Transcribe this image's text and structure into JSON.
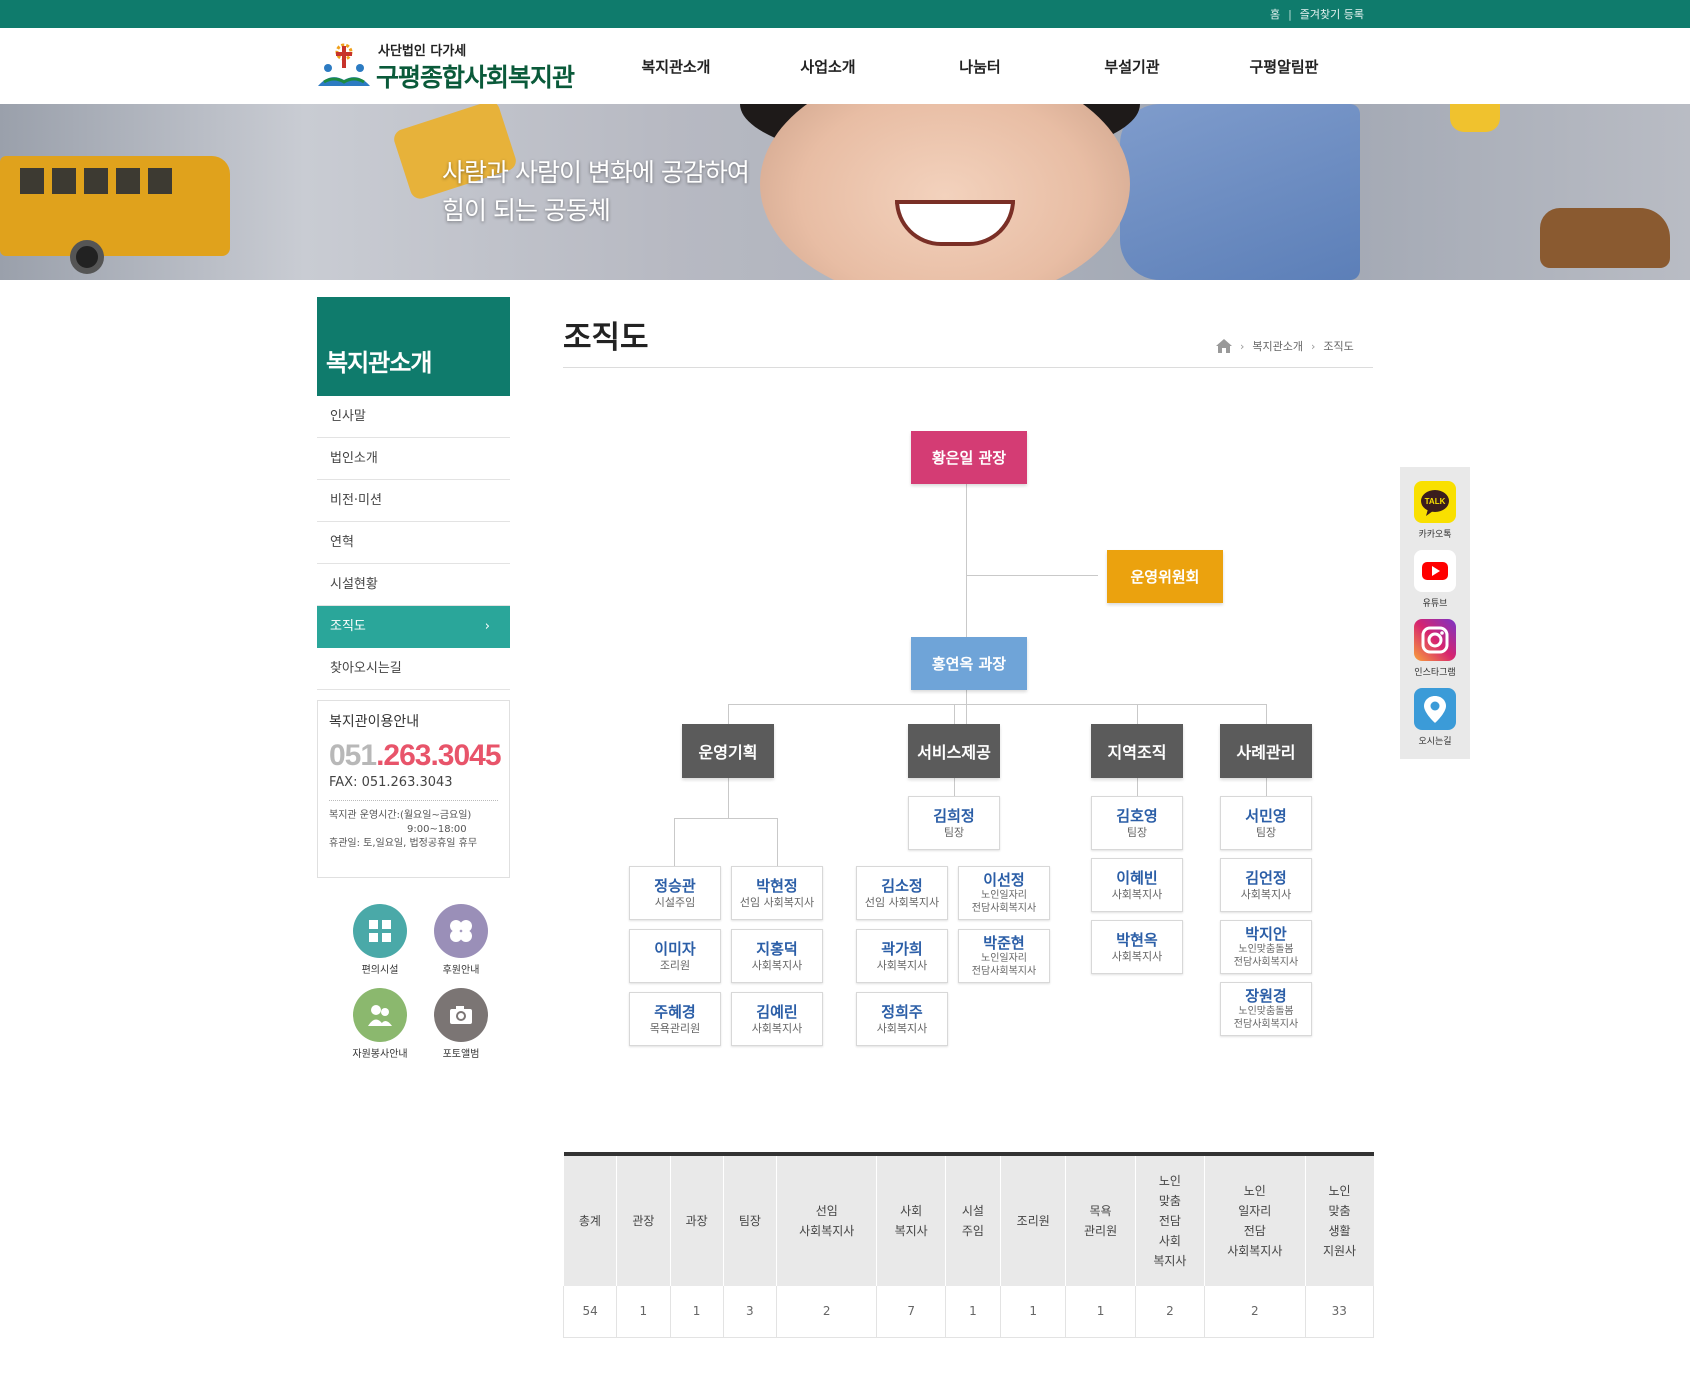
{
  "topbar": {
    "home": "홈",
    "separator": "|",
    "bookmark": "즐겨찾기 등록"
  },
  "logo": {
    "sub": "사단법인 다가세",
    "title": "구평종합사회복지관"
  },
  "gnb": [
    "복지관소개",
    "사업소개",
    "나눔터",
    "부설기관",
    "구평알림판"
  ],
  "banner": {
    "line1": "사람과 사람이 변화에 공감하여",
    "line2": "힘이 되는 공동체"
  },
  "sidebar": {
    "title": "복지관소개",
    "items": [
      {
        "label": "인사말"
      },
      {
        "label": "법인소개"
      },
      {
        "label": "비전·미션"
      },
      {
        "label": "연혁"
      },
      {
        "label": "시설현황"
      },
      {
        "label": "조직도",
        "arrow": "›"
      },
      {
        "label": "찾아오시는길"
      }
    ]
  },
  "info": {
    "title": "복지관이용안내",
    "tel_a": "051",
    "tel_b": ".263.3045",
    "fax": "FAX: 051.263.3043",
    "hours1": "복지관 운영시간:(월요일~금요일)",
    "hours2": "9:00~18:00",
    "holiday": "휴관일: 토,일요일, 법정공휴일 휴무"
  },
  "quick": [
    {
      "label": "편의시설",
      "color": "#4aa9a8"
    },
    {
      "label": "후원안내",
      "color": "#9a8fb8"
    },
    {
      "label": "자원봉사안내",
      "color": "#8bb86e"
    },
    {
      "label": "포토앨범",
      "color": "#7b7574"
    }
  ],
  "page": {
    "title": "조직도"
  },
  "breadcrumb": [
    "복지관소개",
    "조직도"
  ],
  "org": {
    "director": "황은일 관장",
    "committee": "운영위원회",
    "manager": "홍연옥 과장",
    "teams": [
      "운영기획",
      "서비스제공",
      "지역조직",
      "사례관리"
    ],
    "planning": [
      {
        "name": "정승관",
        "role": "시설주임"
      },
      {
        "name": "박현정",
        "role": "선임 사회복지사"
      },
      {
        "name": "이미자",
        "role": "조리원"
      },
      {
        "name": "지홍덕",
        "role": "사회복지사"
      },
      {
        "name": "주혜경",
        "role": "목욕관리원"
      },
      {
        "name": "김예린",
        "role": "사회복지사"
      }
    ],
    "service_head": {
      "name": "김희정",
      "role": "팀장"
    },
    "service": [
      {
        "name": "김소정",
        "role": "선임 사회복지사"
      },
      {
        "name": "이선정",
        "role1": "노인일자리",
        "role2": "전담사회복지사"
      },
      {
        "name": "곽가희",
        "role": "사회복지사"
      },
      {
        "name": "박준현",
        "role1": "노인일자리",
        "role2": "전담사회복지사"
      },
      {
        "name": "정희주",
        "role": "사회복지사"
      }
    ],
    "community_head": {
      "name": "김호영",
      "role": "팀장"
    },
    "community": [
      {
        "name": "이혜빈",
        "role": "사회복지사"
      },
      {
        "name": "박현옥",
        "role": "사회복지사"
      }
    ],
    "case_head": {
      "name": "서민영",
      "role": "팀장"
    },
    "case": [
      {
        "name": "김언정",
        "role": "사회복지사"
      },
      {
        "name": "박지안",
        "role1": "노인맞춤돌봄",
        "role2": "전담사회복지사"
      },
      {
        "name": "장원경",
        "role1": "노인맞춤돌봄",
        "role2": "전담사회복지사"
      }
    ]
  },
  "table": {
    "headers": [
      [
        "총계"
      ],
      [
        "관장"
      ],
      [
        "과장"
      ],
      [
        "팀장"
      ],
      [
        "선임",
        "사회복지사"
      ],
      [
        "사회",
        "복지사"
      ],
      [
        "시설",
        "주임"
      ],
      [
        "조리원"
      ],
      [
        "목욕",
        "관리원"
      ],
      [
        "노인",
        "맞춤",
        "전담",
        "사회",
        "복지사"
      ],
      [
        "노인",
        "일자리",
        "전담",
        "사회복지사"
      ],
      [
        "노인",
        "맞춤",
        "생활",
        "지원사"
      ]
    ],
    "values": [
      "54",
      "1",
      "1",
      "3",
      "2",
      "7",
      "1",
      "1",
      "1",
      "2",
      "2",
      "33"
    ]
  },
  "floating": [
    {
      "label": "카카오톡",
      "badge": "TALK",
      "color": "#f9e000"
    },
    {
      "label": "유튜브",
      "color": "#ffffff"
    },
    {
      "label": "인스타그램",
      "color": "#d6246f"
    },
    {
      "label": "오시는길",
      "color": "#3b9bd8"
    }
  ]
}
